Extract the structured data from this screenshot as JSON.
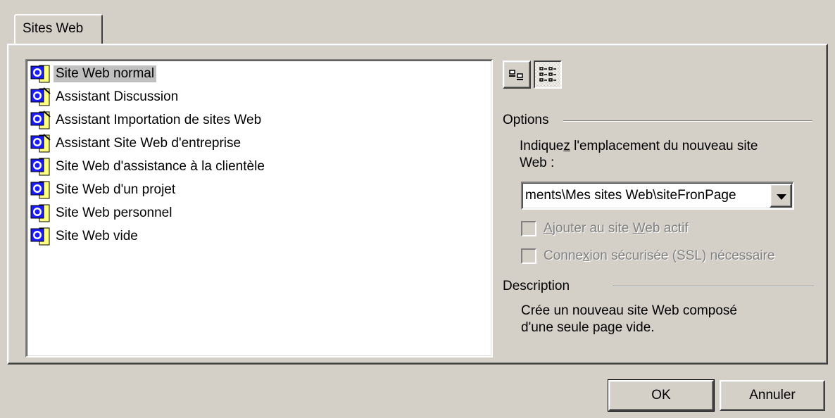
{
  "tabs": [
    {
      "label": "Sites Web",
      "active": true
    }
  ],
  "template_list": {
    "items": [
      {
        "label": "Site Web normal",
        "icon": "web-template-icon",
        "selected": true
      },
      {
        "label": "Assistant Discussion",
        "icon": "wizard-icon",
        "selected": false
      },
      {
        "label": "Assistant Importation de sites Web",
        "icon": "wizard-icon",
        "selected": false
      },
      {
        "label": "Assistant Site Web d'entreprise",
        "icon": "wizard-icon",
        "selected": false
      },
      {
        "label": "Site Web d'assistance à la clientèle",
        "icon": "web-template-icon",
        "selected": false
      },
      {
        "label": "Site Web d'un projet",
        "icon": "web-template-icon",
        "selected": false
      },
      {
        "label": "Site Web personnel",
        "icon": "web-template-icon",
        "selected": false
      },
      {
        "label": "Site Web vide",
        "icon": "web-template-icon",
        "selected": false
      }
    ]
  },
  "view_buttons": [
    {
      "name": "large-icons-view",
      "icon": "large-icons-icon",
      "pressed": false
    },
    {
      "name": "list-view",
      "icon": "list-view-icon",
      "pressed": true
    }
  ],
  "options": {
    "title": "Options",
    "location_label_pre": "Indique",
    "location_label_accel": "z",
    "location_label_post": " l'emplacement du nouveau site",
    "location_label_line2": "Web :",
    "location_value": "ments\\Mes sites Web\\siteFronPage",
    "add_to_current_pre": "",
    "add_to_current_accel": "A",
    "add_to_current_mid": "jouter au site ",
    "add_to_current_accel2": "W",
    "add_to_current_post": "eb actif",
    "add_to_current_checked": false,
    "ssl_pre": "Conne",
    "ssl_accel": "x",
    "ssl_post": "ion sécurisée (SSL) nécessaire",
    "ssl_checked": false
  },
  "description": {
    "title": "Description",
    "line1": "Crée un nouveau site Web composé",
    "line2": "d'une seule page vide."
  },
  "buttons": {
    "ok": "OK",
    "cancel": "Annuler"
  },
  "colors": {
    "face": "#d4d0c8",
    "selection": "#c0c0c0",
    "disabled_text": "#808080"
  }
}
